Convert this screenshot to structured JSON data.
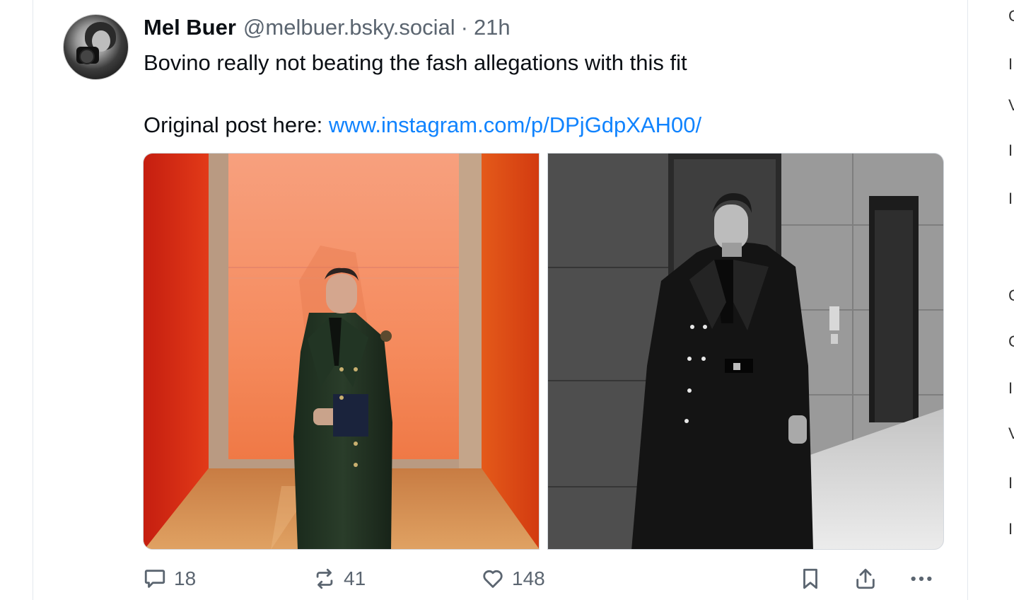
{
  "post": {
    "author_name": "Mel Buer",
    "author_handle": "@melbuer.bsky.social",
    "separator": "·",
    "timestamp": "21h",
    "text_line1": "Bovino really not beating the fash allegations with this fit",
    "link_prefix": "Original post here: ",
    "link_text": "www.instagram.com/p/DPjGdpXAH00/",
    "images": [
      {
        "name": "photo-man-green-coat-orange-lobby"
      },
      {
        "name": "photo-man-coat-bw-hallway"
      }
    ]
  },
  "actions": {
    "reply_count": "18",
    "repost_count": "41",
    "like_count": "148",
    "icons": [
      "reply-icon",
      "repost-icon",
      "like-icon",
      "bookmark-icon",
      "share-icon",
      "more-icon"
    ]
  },
  "colors": {
    "link": "#1083fe",
    "muted": "#5b6570",
    "text": "#0b0f14",
    "border": "#e3e8ee"
  }
}
